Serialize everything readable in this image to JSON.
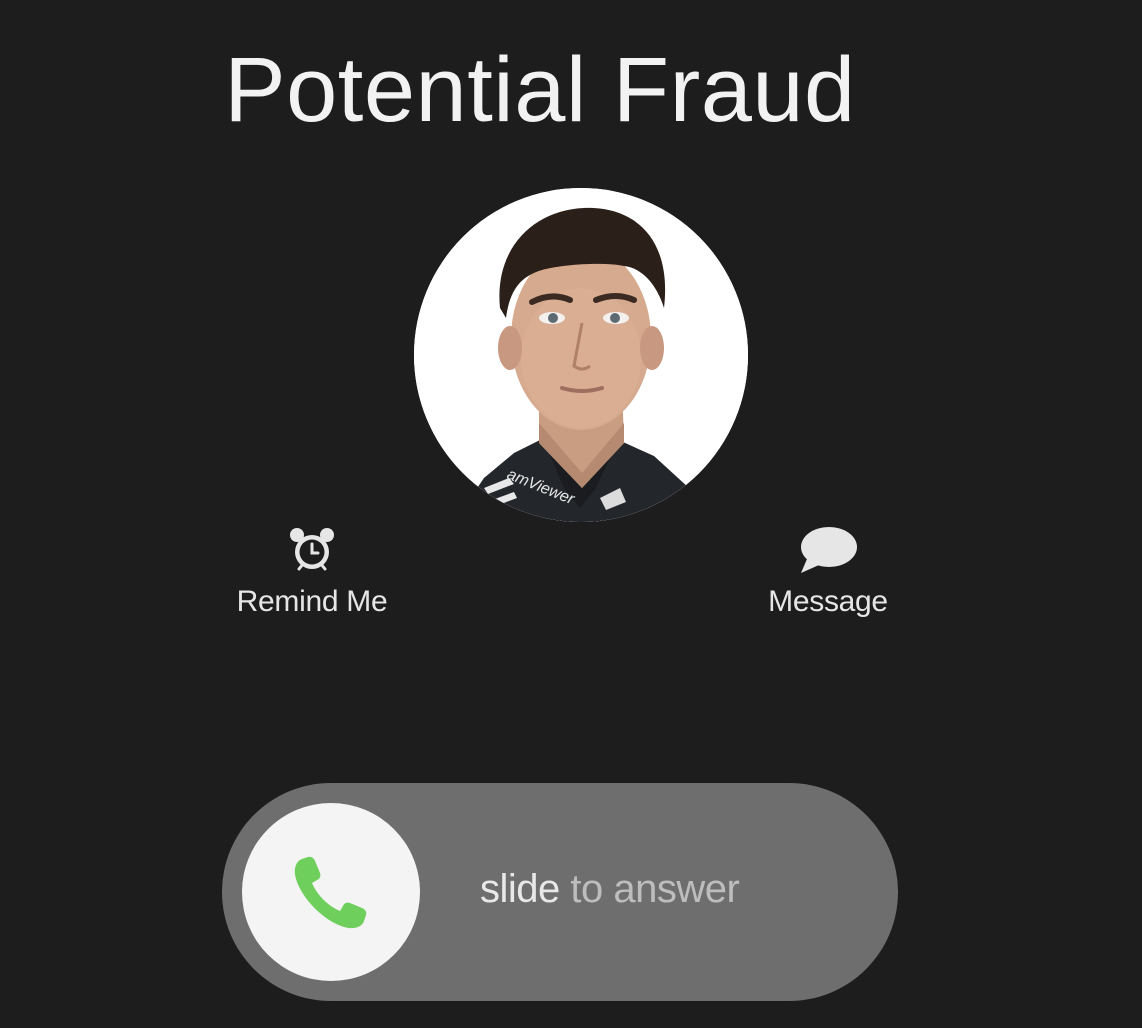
{
  "call": {
    "caller_name": "Potential Fraud"
  },
  "avatar": {
    "jersey_text": "amViewer"
  },
  "actions": {
    "remind_label": "Remind Me",
    "message_label": "Message"
  },
  "slider": {
    "text_bold": "slide",
    "text_rest": " to answer"
  },
  "icons": {
    "remind": "alarm-clock-icon",
    "message": "speech-bubble-icon",
    "answer": "phone-handset-icon"
  },
  "colors": {
    "background": "#1d1d1e",
    "slider_track": "#6e6e6e",
    "answer_green": "#6fcf5c"
  }
}
